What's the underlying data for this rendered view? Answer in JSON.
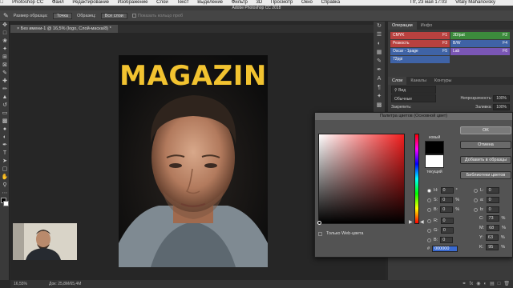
{
  "menubar": {
    "items": [
      "Photoshop CC",
      "Файл",
      "Редактирование",
      "Изображение",
      "Слои",
      "Текст",
      "Выделение",
      "Фильтр",
      "3D",
      "Просмотр",
      "Окно",
      "Справка"
    ],
    "clock": "Пт, 23 мая 17:03",
    "user": "Vitaly Mahanovsky"
  },
  "titlebar": {
    "title": "Adobe Photoshop CC 2018"
  },
  "options": {
    "sample_size_label": "Размер образца:",
    "sample_size_value": "Точка",
    "sample_label": "Образец:",
    "sample_value": "Все слои",
    "show_ring_label": "Показать кольцо проб"
  },
  "document_tab": {
    "title": "Без имени-1 @ 16,5% (logo, Слой-маска/8) *"
  },
  "document": {
    "title": "MAGAZIN"
  },
  "statusbar": {
    "zoom": "16,55%",
    "doc_info": "Док: 25,8M/65,4M"
  },
  "panels": {
    "top_tabs": [
      "Операции",
      "Инфо"
    ],
    "actions": [
      {
        "label": "CMYK",
        "key": "F1",
        "color": "red"
      },
      {
        "label": "3D/pat",
        "key": "F2",
        "color": "green"
      },
      {
        "label": "Резкость",
        "key": "F3",
        "color": "red"
      },
      {
        "label": "B/W",
        "key": "F4",
        "color": "blue"
      },
      {
        "label": "Oscar - 1page",
        "key": "F5",
        "color": "blue"
      },
      {
        "label": "Lab",
        "key": "F6",
        "color": "purple"
      },
      {
        "label": "72ppi",
        "key": "",
        "color": "blue"
      }
    ],
    "layer_tabs": [
      "Слои",
      "Каналы",
      "Контуры"
    ],
    "layer_kind": "Вид",
    "blend_mode": "Обычные",
    "opacity_label": "Непрозрачность:",
    "opacity_value": "100%",
    "lock_label": "Закрепить:",
    "fill_label": "Заливка:",
    "fill_value": "100%"
  },
  "picker": {
    "title": "Палитра цветов (Основной цвет)",
    "new_label": "новый",
    "current_label": "текущий",
    "ok": "OK",
    "cancel": "Отмена",
    "add_swatch": "Добавить в образцы",
    "libraries": "Библиотеки цветов",
    "web_only": "Только Web-цвета",
    "hsb": {
      "H": "0",
      "S": "0",
      "B": "0"
    },
    "rgb": {
      "R": "0",
      "G": "0",
      "B": "0"
    },
    "lab": {
      "L": "0",
      "a": "0",
      "b": "0"
    },
    "cmyk": {
      "C": "73",
      "M": "68",
      "Y": "63",
      "K": "95"
    },
    "hex": "000000",
    "units": {
      "deg": "°",
      "pct": "%"
    }
  },
  "colors": {
    "accent_yellow": "#f2c330",
    "hex_highlight": "#3a6ad0"
  }
}
